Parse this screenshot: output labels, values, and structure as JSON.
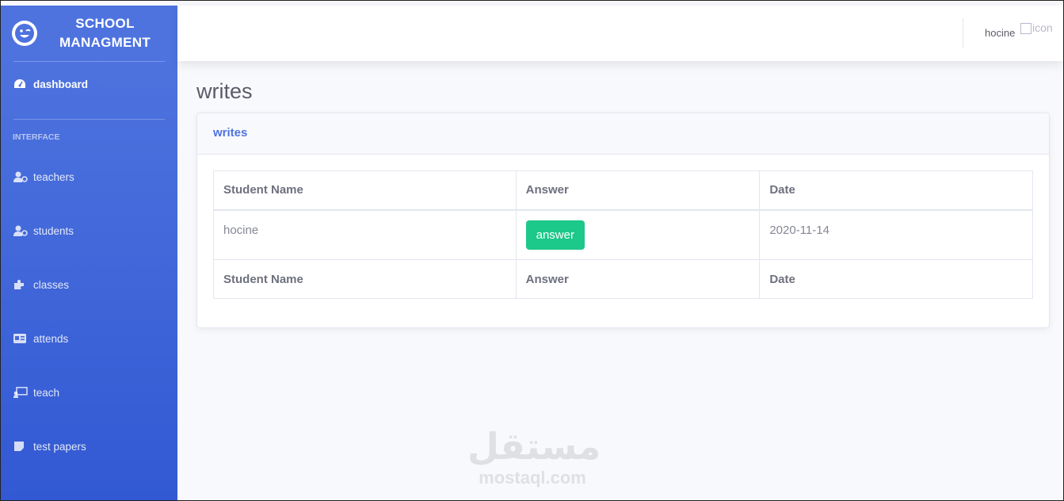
{
  "sidebar": {
    "brand": "SCHOOL MANAGMENT",
    "brand_line1": "SCHOOL",
    "brand_line2": "MANAGMENT",
    "dashboard": {
      "label": "dashboard",
      "icon": "tachometer-icon"
    },
    "heading": "INTERFACE",
    "items": [
      {
        "label": "teachers",
        "icon": "user-cog-icon"
      },
      {
        "label": "students",
        "icon": "user-cog-icon"
      },
      {
        "label": "classes",
        "icon": "puzzle-icon"
      },
      {
        "label": "attends",
        "icon": "id-card-icon"
      },
      {
        "label": "teach",
        "icon": "chalkboard-teacher-icon"
      },
      {
        "label": "test papers",
        "icon": "sticky-note-icon"
      }
    ]
  },
  "topbar": {
    "user_name": "hocine",
    "user_img_alt": "icon"
  },
  "page": {
    "title": "writes",
    "card_title": "writes"
  },
  "table": {
    "headers": [
      "Student Name",
      "Answer",
      "Date"
    ],
    "rows": [
      {
        "student": "hocine",
        "answer_label": "answer",
        "date": "2020-11-14"
      }
    ],
    "footers": [
      "Student Name",
      "Answer",
      "Date"
    ]
  },
  "watermark": {
    "arabic": "مستقل",
    "latin": "mostaql.com"
  },
  "colors": {
    "sidebar_start": "#4e73df",
    "sidebar_end": "#3259d3",
    "primary": "#4e73df",
    "success": "#1cc88a"
  }
}
